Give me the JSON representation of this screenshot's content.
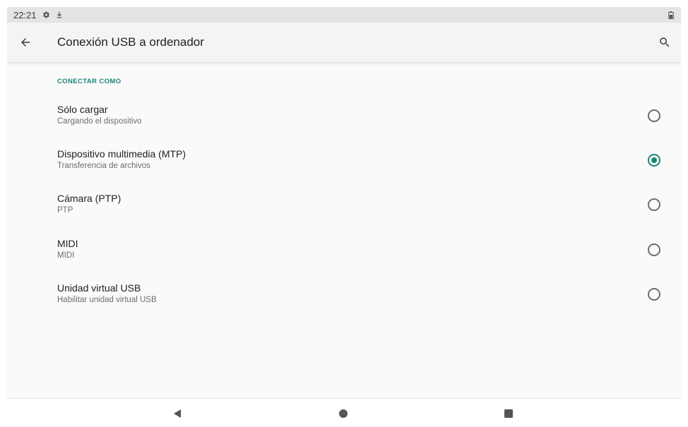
{
  "status_bar": {
    "time": "22:21",
    "icons": [
      "gear-icon",
      "download-icon",
      "battery-icon"
    ]
  },
  "app_bar": {
    "title": "Conexión USB a ordenador",
    "back_icon": "arrow-left-icon",
    "search_icon": "search-icon"
  },
  "section": {
    "header": "CONECTAR COMO"
  },
  "options": [
    {
      "title": "Sólo cargar",
      "summary": "Cargando el dispositivo",
      "selected": false
    },
    {
      "title": "Dispositivo multimedia (MTP)",
      "summary": "Transferencia de archivos",
      "selected": true
    },
    {
      "title": "Cámara (PTP)",
      "summary": "PTP",
      "selected": false
    },
    {
      "title": "MIDI",
      "summary": "MIDI",
      "selected": false
    },
    {
      "title": "Unidad virtual USB",
      "summary": "Habilitar unidad virtual USB",
      "selected": false
    }
  ],
  "nav_bar": {
    "icons": [
      "back-triangle-icon",
      "home-circle-icon",
      "recents-square-icon"
    ]
  },
  "colors": {
    "accent": "#1a8577",
    "status_bar_bg": "#e4e4e4",
    "app_bar_bg": "#f4f4f4",
    "content_bg": "#fafafa"
  }
}
